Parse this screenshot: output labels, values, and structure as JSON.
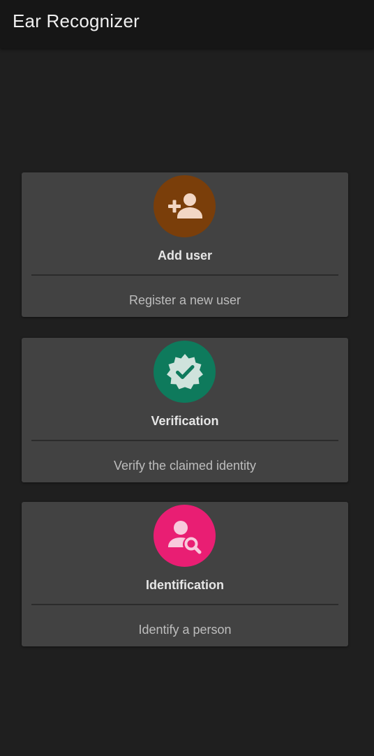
{
  "app": {
    "title": "Ear Recognizer"
  },
  "cards": [
    {
      "title": "Add user",
      "subtitle": "Register a new user",
      "icon": "person-add-icon",
      "color": "#7a3e0a"
    },
    {
      "title": "Verification",
      "subtitle": "Verify the claimed identity",
      "icon": "verified-badge-icon",
      "color": "#0e7a5c"
    },
    {
      "title": "Identification",
      "subtitle": "Identify a person",
      "icon": "person-search-icon",
      "color": "#e91e73"
    }
  ],
  "colors": {
    "background": "#1f1f1f",
    "appbar": "#161616",
    "card": "#424242",
    "icon_glyph": "#f2d6c4"
  }
}
